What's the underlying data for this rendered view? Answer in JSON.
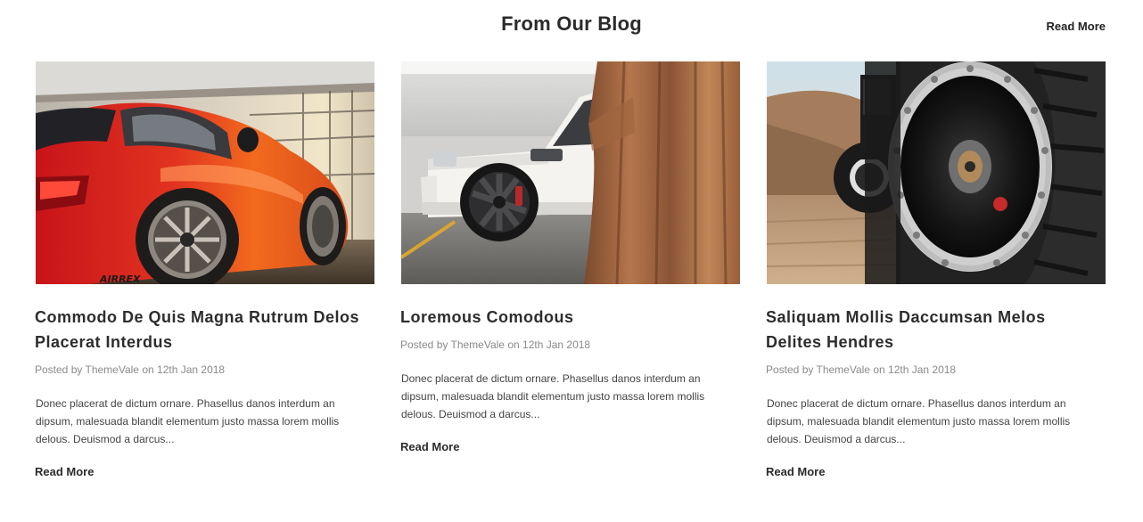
{
  "section": {
    "title": "From Our Blog",
    "read_more": "Read More"
  },
  "posts": [
    {
      "title": "Commodo De Quis Magna Rutrum Delos Placerat Interdus",
      "posted_by": "Posted by",
      "author": "ThemeVale",
      "on": "on",
      "date": "12th Jan 2018",
      "excerpt": "Donec placerat de dictum ornare. Phasellus danos interdum an dipsum, malesuada blandit elementum justo massa lorem mollis delous. Deuismod a darcus...",
      "read_more": "Read More",
      "image": "red-sports-car-photo"
    },
    {
      "title": "Loremous Comodous",
      "posted_by": "Posted by",
      "author": "ThemeVale",
      "on": "on",
      "date": "12th Jan 2018",
      "excerpt": "Donec placerat de dictum ornare. Phasellus danos interdum an dipsum, malesuada blandit elementum justo massa lorem mollis delous. Deuismod a darcus...",
      "read_more": "Read More",
      "image": "white-suv-photo"
    },
    {
      "title": "Saliquam Mollis Daccumsan Melos Delites Hendres",
      "posted_by": "Posted by",
      "author": "ThemeVale",
      "on": "on",
      "date": "12th Jan 2018",
      "excerpt": "Donec placerat de dictum ornare. Phasellus danos interdum an dipsum, malesuada blandit elementum justo massa lorem mollis delous. Deuismod a darcus...",
      "read_more": "Read More",
      "image": "offroad-tire-photo"
    }
  ],
  "colors": {
    "heading": "#2d2d2d",
    "meta": "#8a8a8a",
    "body_text": "#444444",
    "background": "#ffffff"
  }
}
